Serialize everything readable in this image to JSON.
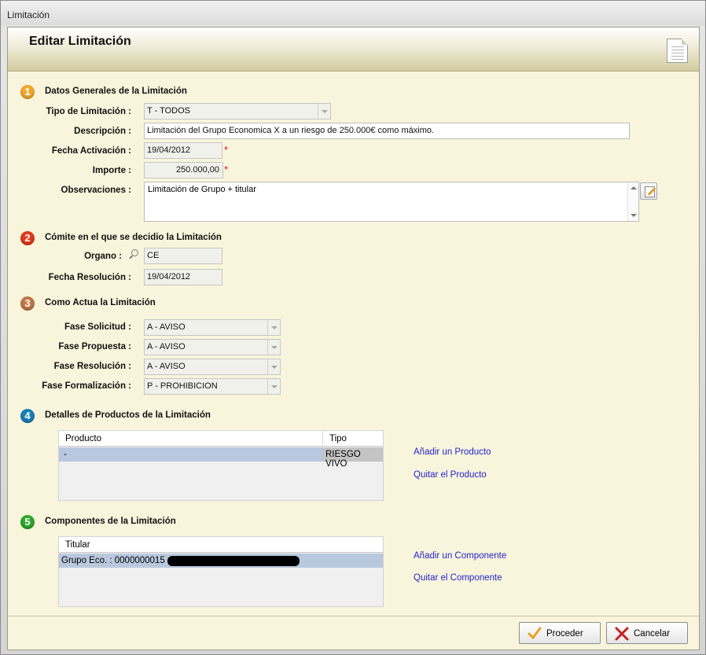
{
  "window": {
    "title": "Limitación"
  },
  "header": {
    "title": "Editar Limitación",
    "icon": "document-icon"
  },
  "sections": {
    "s1": {
      "number": "1",
      "color": "#f0a830",
      "title": "Datos Generales de la Limitación"
    },
    "s2": {
      "number": "2",
      "color": "#e2391a",
      "title": "Cómite en el que se decidio la Limitación"
    },
    "s3": {
      "number": "3",
      "color": "#c07848",
      "title": "Como Actua la Limitación"
    },
    "s4": {
      "number": "4",
      "color": "#1a7fb8",
      "title": "Detalles de Productos de la Limitación"
    },
    "s5": {
      "number": "5",
      "color": "#2ca82c",
      "title": "Componentes de la Limitación"
    }
  },
  "general": {
    "tipo_label": "Tipo de Limitación :",
    "tipo_value": "T - TODOS",
    "descripcion_label": "Descripción :",
    "descripcion_value": "Limitación del Grupo Economica X a un riesgo de 250.000€ como máximo.",
    "fecha_activacion_label": "Fecha Activación :",
    "fecha_activacion_value": "19/04/2012",
    "importe_label": "Importe :",
    "importe_value": "250.000,00",
    "observaciones_label": "Observaciones :",
    "observaciones_value": "Limitación de Grupo + titular",
    "required_mark": "*"
  },
  "comite": {
    "organo_label": "Organo :",
    "organo_value": "CE",
    "fecha_resolucion_label": "Fecha Resolución :",
    "fecha_resolucion_value": "19/04/2012"
  },
  "actua": {
    "fase_solicitud_label": "Fase Solicitud :",
    "fase_solicitud_value": "A - AVISO",
    "fase_propuesta_label": "Fase Propuesta :",
    "fase_propuesta_value": "A - AVISO",
    "fase_resolucion_label": "Fase Resolución :",
    "fase_resolucion_value": "A - AVISO",
    "fase_formalizacion_label": "Fase Formalización :",
    "fase_formalizacion_value": "P - PROHIBICION"
  },
  "productos": {
    "columns": [
      "Producto",
      "Tipo"
    ],
    "rows": [
      {
        "producto": "-",
        "tipo": "RIESGO VIVO"
      }
    ],
    "add_link": "Añadir un Producto",
    "remove_link": "Quitar el Producto"
  },
  "componentes": {
    "columns": [
      "Titular"
    ],
    "rows": [
      {
        "titular": "Grupo Eco. :  0000000015 -"
      }
    ],
    "add_link": "Añadir un Componente",
    "remove_link": "Quitar el Componente"
  },
  "footer": {
    "proceed_label": "Proceder",
    "cancel_label": "Cancelar"
  },
  "colors": {
    "panel_bg": "#f8f5dc",
    "selected_row": "#b9c8de",
    "link": "#2222cc"
  }
}
